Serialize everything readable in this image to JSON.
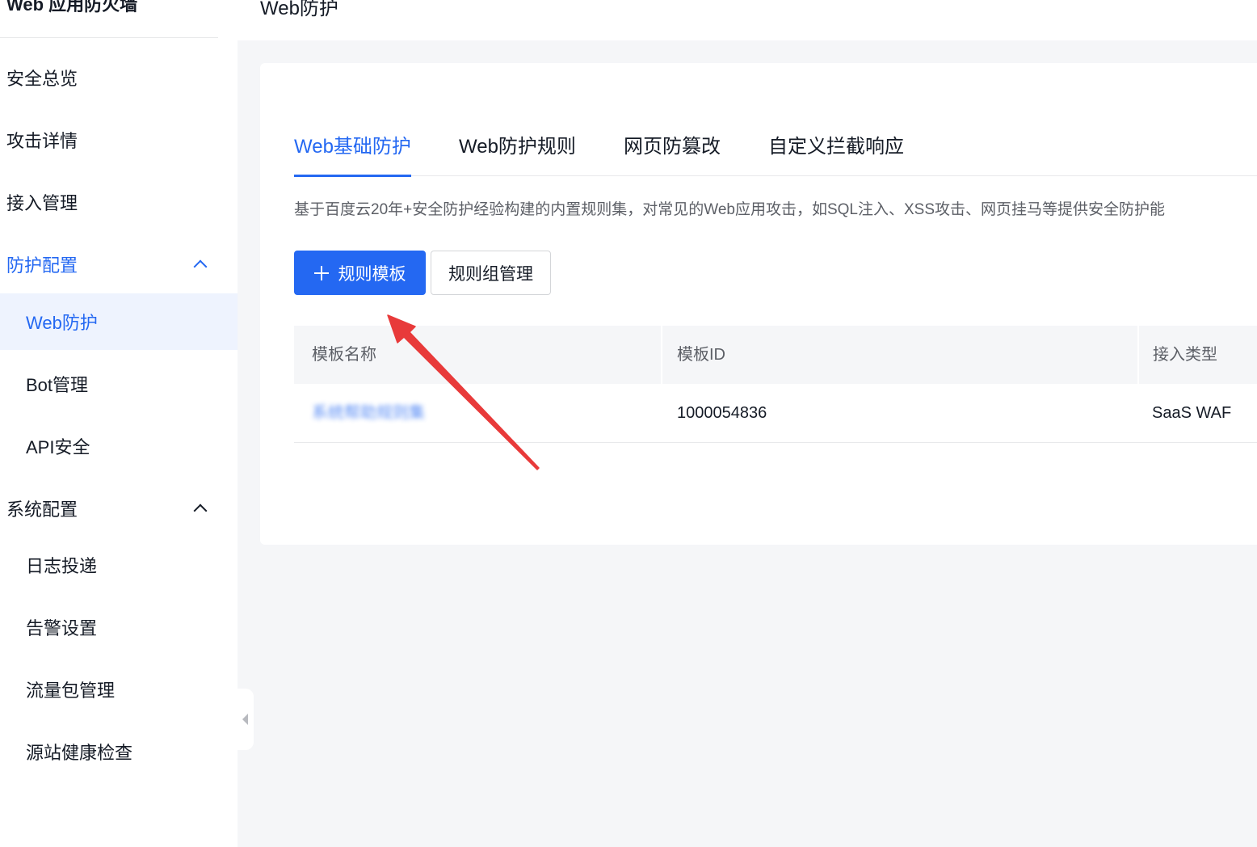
{
  "app": {
    "title": "Web 应用防火墙",
    "page_title": "Web防护"
  },
  "sidebar": {
    "items": [
      {
        "label": "安全总览"
      },
      {
        "label": "攻击详情"
      },
      {
        "label": "接入管理"
      },
      {
        "label": "防护配置"
      },
      {
        "label": "Web防护"
      },
      {
        "label": "Bot管理"
      },
      {
        "label": "API安全"
      },
      {
        "label": "系统配置"
      },
      {
        "label": "日志投递"
      },
      {
        "label": "告警设置"
      },
      {
        "label": "流量包管理"
      },
      {
        "label": "源站健康检查"
      }
    ]
  },
  "tabs": [
    {
      "label": "Web基础防护",
      "active": true
    },
    {
      "label": "Web防护规则"
    },
    {
      "label": "网页防篡改"
    },
    {
      "label": "自定义拦截响应"
    }
  ],
  "description": "基于百度云20年+安全防护经验构建的内置规则集，对常见的Web应用攻击，如SQL注入、XSS攻击、网页挂马等提供安全防护能",
  "buttons": {
    "add_template": "规则模板",
    "group_manage": "规则组管理"
  },
  "table": {
    "columns": [
      "模板名称",
      "模板ID",
      "接入类型"
    ],
    "rows": [
      {
        "name": "系统帮助规则集",
        "id": "1000054836",
        "type": "SaaS WAF"
      }
    ]
  },
  "colors": {
    "primary": "#2468f2",
    "annotation_arrow": "#e83a3a"
  }
}
